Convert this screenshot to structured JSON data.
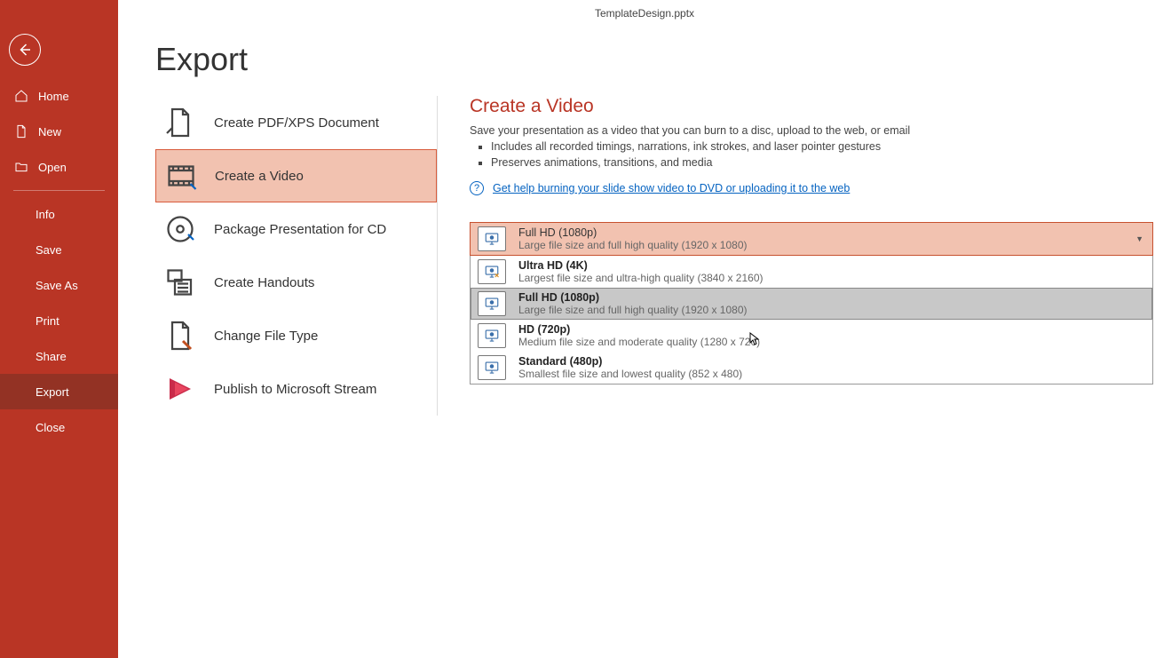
{
  "titlebar": {
    "filename": "TemplateDesign.pptx"
  },
  "page": {
    "title": "Export"
  },
  "sidebar": {
    "home": "Home",
    "new": "New",
    "open": "Open",
    "info": "Info",
    "save": "Save",
    "saveas": "Save As",
    "print": "Print",
    "share": "Share",
    "export": "Export",
    "close": "Close"
  },
  "options": {
    "pdf": "Create PDF/XPS Document",
    "video": "Create a Video",
    "cd": "Package Presentation for CD",
    "handouts": "Create Handouts",
    "filetype": "Change File Type",
    "stream": "Publish to Microsoft Stream"
  },
  "panel": {
    "heading": "Create a Video",
    "desc": "Save your presentation as a video that you can burn to a disc, upload to the web, or email",
    "bullet1": "Includes all recorded timings, narrations, ink strokes, and laser pointer gestures",
    "bullet2": "Preserves animations, transitions, and media",
    "help_link": "Get help burning your slide show video to DVD or uploading it to the web"
  },
  "dropdown": {
    "selected_title": "Full HD (1080p)",
    "selected_desc": "Large file size and full high quality (1920 x 1080)",
    "items": [
      {
        "title": "Ultra HD (4K)",
        "desc": "Largest file size and ultra-high quality (3840 x 2160)"
      },
      {
        "title": "Full HD (1080p)",
        "desc": "Large file size and full high quality (1920 x 1080)"
      },
      {
        "title": "HD (720p)",
        "desc": "Medium file size and moderate quality (1280 x 720)"
      },
      {
        "title": "Standard (480p)",
        "desc": "Smallest file size and lowest quality (852 x 480)"
      }
    ]
  }
}
